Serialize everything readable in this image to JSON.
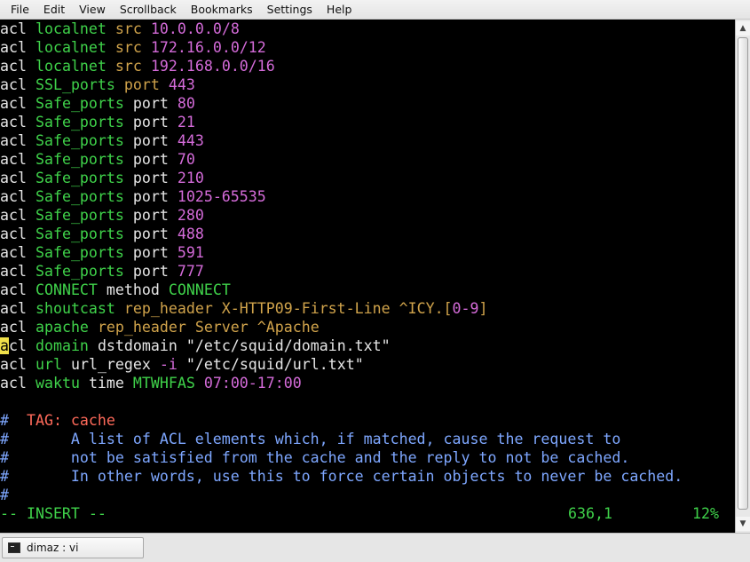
{
  "menubar": {
    "items": [
      "File",
      "Edit",
      "View",
      "Scrollback",
      "Bookmarks",
      "Settings",
      "Help"
    ]
  },
  "colors": {
    "background": "#000000",
    "keyword": "#e6e6e6",
    "name": "#3fd24a",
    "type": "#d0a34b",
    "value": "#d46bd9",
    "string": "#e6e6e6",
    "comment_tag": "#ff6a5a",
    "comment": "#7ea7ff",
    "cursor": "#f0e14a"
  },
  "editor": {
    "lines": [
      [
        [
          "acl",
          "keyword"
        ],
        [
          " ",
          "plain"
        ],
        [
          "localnet",
          "name"
        ],
        [
          " ",
          "plain"
        ],
        [
          "src",
          "type"
        ],
        [
          " ",
          "plain"
        ],
        [
          "10.0.0.0/8",
          "value"
        ]
      ],
      [
        [
          "acl",
          "keyword"
        ],
        [
          " ",
          "plain"
        ],
        [
          "localnet",
          "name"
        ],
        [
          " ",
          "plain"
        ],
        [
          "src",
          "type"
        ],
        [
          " ",
          "plain"
        ],
        [
          "172.16.0.0/12",
          "value"
        ]
      ],
      [
        [
          "acl",
          "keyword"
        ],
        [
          " ",
          "plain"
        ],
        [
          "localnet",
          "name"
        ],
        [
          " ",
          "plain"
        ],
        [
          "src",
          "type"
        ],
        [
          " ",
          "plain"
        ],
        [
          "192.168.0.0/16",
          "value"
        ]
      ],
      [
        [
          "acl",
          "keyword"
        ],
        [
          " ",
          "plain"
        ],
        [
          "SSL_ports",
          "name"
        ],
        [
          " ",
          "plain"
        ],
        [
          "port",
          "type"
        ],
        [
          " ",
          "plain"
        ],
        [
          "443",
          "value"
        ]
      ],
      [
        [
          "acl",
          "keyword"
        ],
        [
          " ",
          "plain"
        ],
        [
          "Safe_ports",
          "name"
        ],
        [
          " ",
          "plain"
        ],
        [
          "port",
          "keyword"
        ],
        [
          " ",
          "plain"
        ],
        [
          "80",
          "value"
        ]
      ],
      [
        [
          "acl",
          "keyword"
        ],
        [
          " ",
          "plain"
        ],
        [
          "Safe_ports",
          "name"
        ],
        [
          " ",
          "plain"
        ],
        [
          "port",
          "keyword"
        ],
        [
          " ",
          "plain"
        ],
        [
          "21",
          "value"
        ]
      ],
      [
        [
          "acl",
          "keyword"
        ],
        [
          " ",
          "plain"
        ],
        [
          "Safe_ports",
          "name"
        ],
        [
          " ",
          "plain"
        ],
        [
          "port",
          "keyword"
        ],
        [
          " ",
          "plain"
        ],
        [
          "443",
          "value"
        ]
      ],
      [
        [
          "acl",
          "keyword"
        ],
        [
          " ",
          "plain"
        ],
        [
          "Safe_ports",
          "name"
        ],
        [
          " ",
          "plain"
        ],
        [
          "port",
          "keyword"
        ],
        [
          " ",
          "plain"
        ],
        [
          "70",
          "value"
        ]
      ],
      [
        [
          "acl",
          "keyword"
        ],
        [
          " ",
          "plain"
        ],
        [
          "Safe_ports",
          "name"
        ],
        [
          " ",
          "plain"
        ],
        [
          "port",
          "keyword"
        ],
        [
          " ",
          "plain"
        ],
        [
          "210",
          "value"
        ]
      ],
      [
        [
          "acl",
          "keyword"
        ],
        [
          " ",
          "plain"
        ],
        [
          "Safe_ports",
          "name"
        ],
        [
          " ",
          "plain"
        ],
        [
          "port",
          "keyword"
        ],
        [
          " ",
          "plain"
        ],
        [
          "1025-65535",
          "value"
        ]
      ],
      [
        [
          "acl",
          "keyword"
        ],
        [
          " ",
          "plain"
        ],
        [
          "Safe_ports",
          "name"
        ],
        [
          " ",
          "plain"
        ],
        [
          "port",
          "keyword"
        ],
        [
          " ",
          "plain"
        ],
        [
          "280",
          "value"
        ]
      ],
      [
        [
          "acl",
          "keyword"
        ],
        [
          " ",
          "plain"
        ],
        [
          "Safe_ports",
          "name"
        ],
        [
          " ",
          "plain"
        ],
        [
          "port",
          "keyword"
        ],
        [
          " ",
          "plain"
        ],
        [
          "488",
          "value"
        ]
      ],
      [
        [
          "acl",
          "keyword"
        ],
        [
          " ",
          "plain"
        ],
        [
          "Safe_ports",
          "name"
        ],
        [
          " ",
          "plain"
        ],
        [
          "port",
          "keyword"
        ],
        [
          " ",
          "plain"
        ],
        [
          "591",
          "value"
        ]
      ],
      [
        [
          "acl",
          "keyword"
        ],
        [
          " ",
          "plain"
        ],
        [
          "Safe_ports",
          "name"
        ],
        [
          " ",
          "plain"
        ],
        [
          "port",
          "keyword"
        ],
        [
          " ",
          "plain"
        ],
        [
          "777",
          "value"
        ]
      ],
      [
        [
          "acl",
          "keyword"
        ],
        [
          " ",
          "plain"
        ],
        [
          "CONNECT",
          "name"
        ],
        [
          " ",
          "plain"
        ],
        [
          "method",
          "keyword"
        ],
        [
          " ",
          "plain"
        ],
        [
          "CONNECT",
          "name"
        ]
      ],
      [
        [
          "acl",
          "keyword"
        ],
        [
          " ",
          "plain"
        ],
        [
          "shoutcast",
          "name"
        ],
        [
          " ",
          "plain"
        ],
        [
          "rep_header X-HTTP09-First-Line ^ICY.[",
          "type"
        ],
        [
          "0-9",
          "value"
        ],
        [
          "]",
          "type"
        ]
      ],
      [
        [
          "acl",
          "keyword"
        ],
        [
          " ",
          "plain"
        ],
        [
          "apache",
          "name"
        ],
        [
          " ",
          "plain"
        ],
        [
          "rep_header Server ^Apache",
          "type"
        ]
      ],
      [
        [
          "a",
          "cursor"
        ],
        [
          "cl",
          "keyword"
        ],
        [
          " ",
          "plain"
        ],
        [
          "domain",
          "name"
        ],
        [
          " ",
          "plain"
        ],
        [
          "dstdomain",
          "keyword"
        ],
        [
          " ",
          "plain"
        ],
        [
          "\"/etc/squid/domain.txt\"",
          "string"
        ]
      ],
      [
        [
          "acl",
          "keyword"
        ],
        [
          " ",
          "plain"
        ],
        [
          "url",
          "name"
        ],
        [
          " ",
          "plain"
        ],
        [
          "url_regex",
          "keyword"
        ],
        [
          " ",
          "plain"
        ],
        [
          "-i",
          "value"
        ],
        [
          " ",
          "plain"
        ],
        [
          "\"/etc/squid/url.txt\"",
          "string"
        ]
      ],
      [
        [
          "acl",
          "keyword"
        ],
        [
          " ",
          "plain"
        ],
        [
          "waktu",
          "name"
        ],
        [
          " ",
          "plain"
        ],
        [
          "time",
          "keyword"
        ],
        [
          " ",
          "plain"
        ],
        [
          "MTWHFAS",
          "name"
        ],
        [
          " ",
          "plain"
        ],
        [
          "07:00-17:00",
          "value"
        ]
      ],
      [],
      [
        [
          "#",
          "comment"
        ],
        [
          "  ",
          "plain"
        ],
        [
          "TAG: cache",
          "comment_tag"
        ]
      ],
      [
        [
          "#",
          "comment"
        ],
        [
          "       A list of ACL elements which, if matched, cause the request to",
          "comment"
        ]
      ],
      [
        [
          "#",
          "comment"
        ],
        [
          "       not be satisfied from the cache and the reply to not be cached.",
          "comment"
        ]
      ],
      [
        [
          "#",
          "comment"
        ],
        [
          "       In other words, use this to force certain objects to never be cached.",
          "comment"
        ]
      ],
      [
        [
          "#",
          "comment"
        ]
      ]
    ]
  },
  "status": {
    "mode": "-- INSERT --",
    "position": "636,1",
    "percent": "12%"
  },
  "scrollbar": {
    "up_icon": "arrow-up-icon",
    "down_icon": "arrow-down-icon",
    "position_fraction": 0.12
  },
  "tabbar": {
    "session_label": "dimaz : vi",
    "icon": "terminal-icon"
  }
}
